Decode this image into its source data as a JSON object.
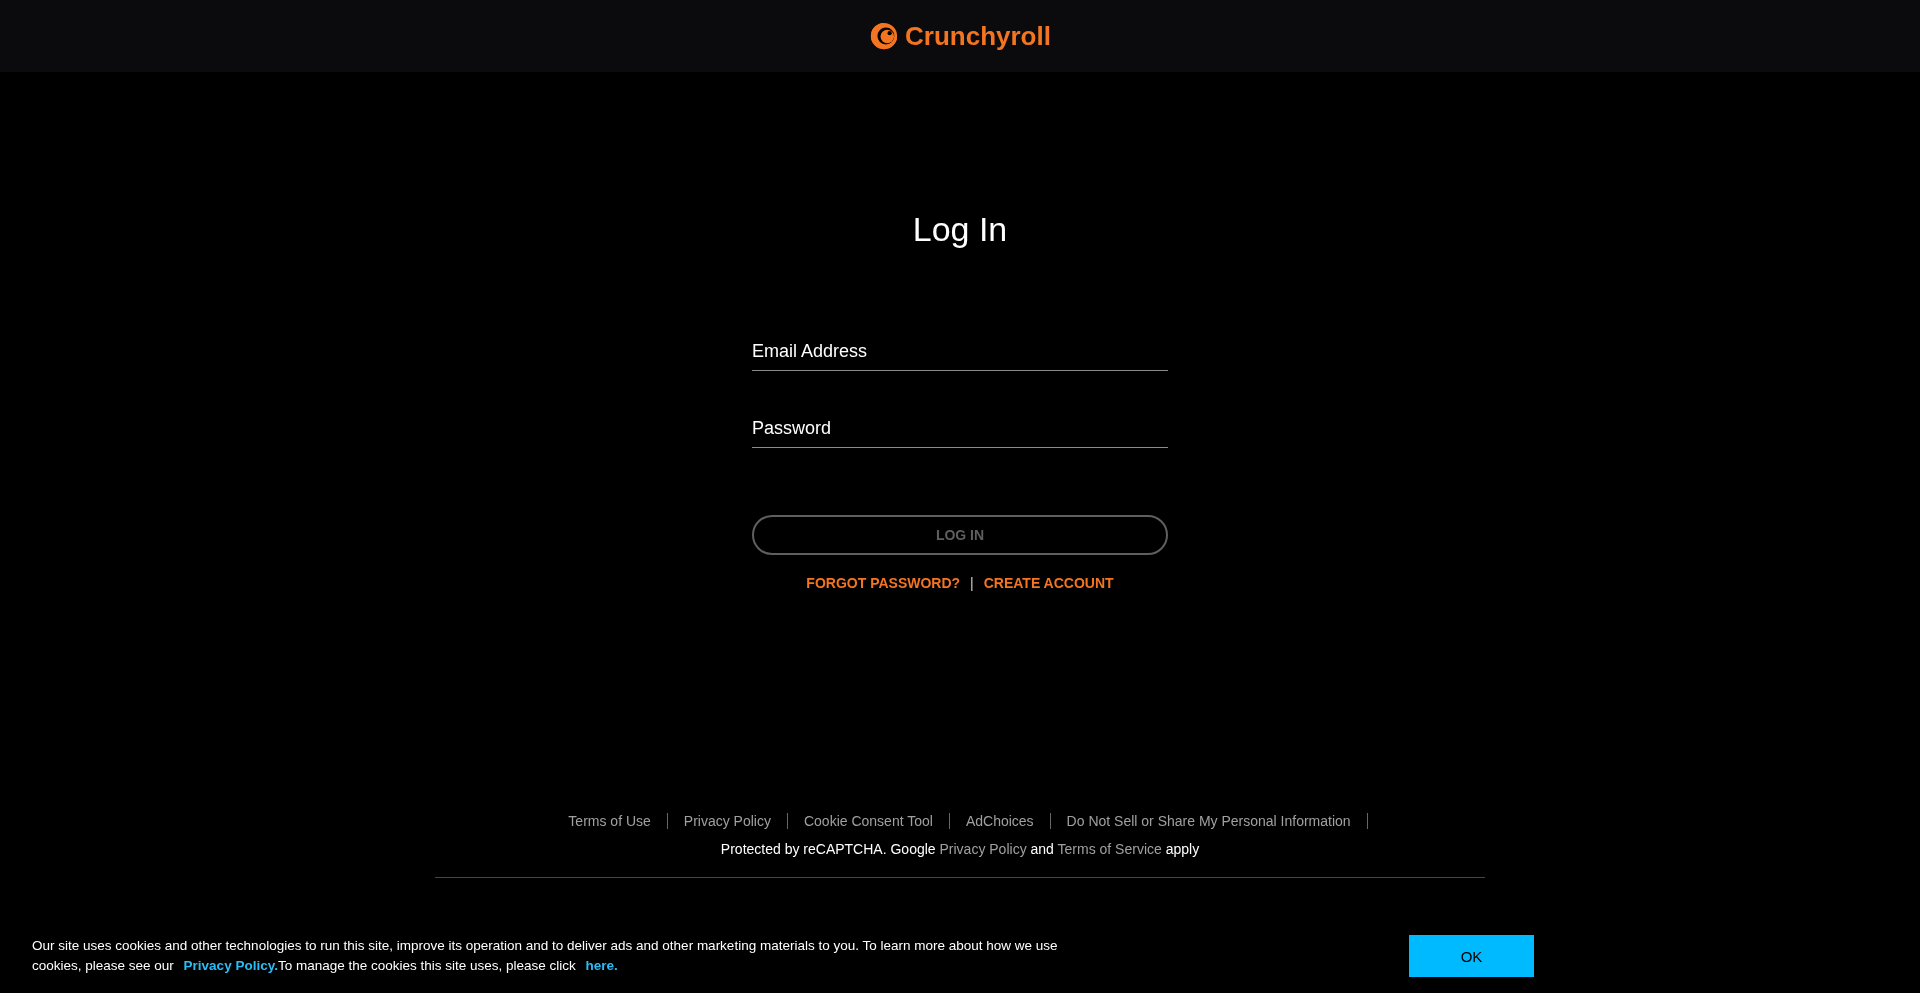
{
  "header": {
    "logo_text": "Crunchyroll"
  },
  "login": {
    "title": "Log In",
    "fields": [
      {
        "placeholder": "Email Address"
      },
      {
        "placeholder": "Password"
      }
    ],
    "submit": {
      "label": "LOG IN",
      "disabled": true
    },
    "links": [
      {
        "label": "FORGOT PASSWORD?"
      },
      {
        "label": "CREATE ACCOUNT"
      }
    ],
    "separator": "|"
  },
  "footer": {
    "links": [
      "Terms of Use",
      "Privacy Policy",
      "Cookie Consent Tool",
      "AdChoices",
      "Do Not Sell or Share My Personal Information"
    ],
    "recaptcha": {
      "before": "Protected by reCAPTCHA. Google",
      "link_1": "Privacy Policy",
      "middle": "and",
      "link_2": "Terms of Service",
      "after": "apply"
    }
  },
  "cookie_banner": {
    "text_1": "Our site uses cookies and other technologies to run this site, improve its operation and to deliver ads and other marketing materials to you.  To learn more about how we use cookies, please see our",
    "link_1": "Privacy Policy.",
    "text_2": "To manage the cookies this site uses, please click",
    "link_2": "here.",
    "button": "OK"
  }
}
